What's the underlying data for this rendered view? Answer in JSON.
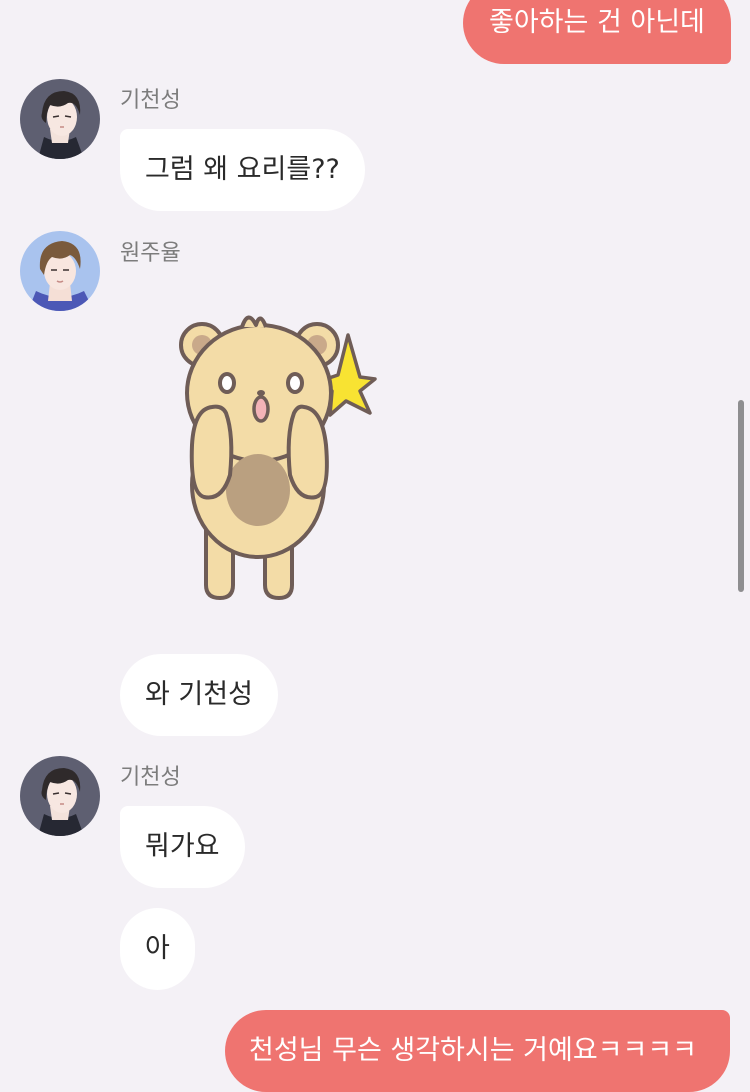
{
  "messages": [
    {
      "id": "m1",
      "direction": "out",
      "text": "좋아하는 건 아닌데"
    },
    {
      "id": "m2",
      "direction": "in",
      "sender": "기천성",
      "text": "그럼 왜 요리를??"
    },
    {
      "id": "m3",
      "direction": "in",
      "sender": "원주율",
      "type": "sticker",
      "sticker": "surprised-bear-sticker"
    },
    {
      "id": "m4",
      "direction": "in",
      "sender": "원주율",
      "text": "와 기천성"
    },
    {
      "id": "m5",
      "direction": "in",
      "sender": "기천성",
      "text": "뭐가요"
    },
    {
      "id": "m6",
      "direction": "in",
      "sender": "기천성",
      "text": "아"
    },
    {
      "id": "m7",
      "direction": "out",
      "text": "천성님 무슨 생각하시는 거예요ㅋㅋㅋㅋ"
    }
  ],
  "senders": {
    "gi_cheonseong": "기천성",
    "won_juyul": "원주율"
  },
  "colors": {
    "background": "#f4f1f6",
    "outgoing_bubble": "#ef7470",
    "incoming_bubble": "#ffffff",
    "sender_name": "#7c7c7c"
  },
  "icons": {
    "avatar_cheonseong": "dark-haired-man-avatar",
    "avatar_juyul": "brown-haired-man-avatar",
    "sticker": "surprised-bear-sticker"
  }
}
